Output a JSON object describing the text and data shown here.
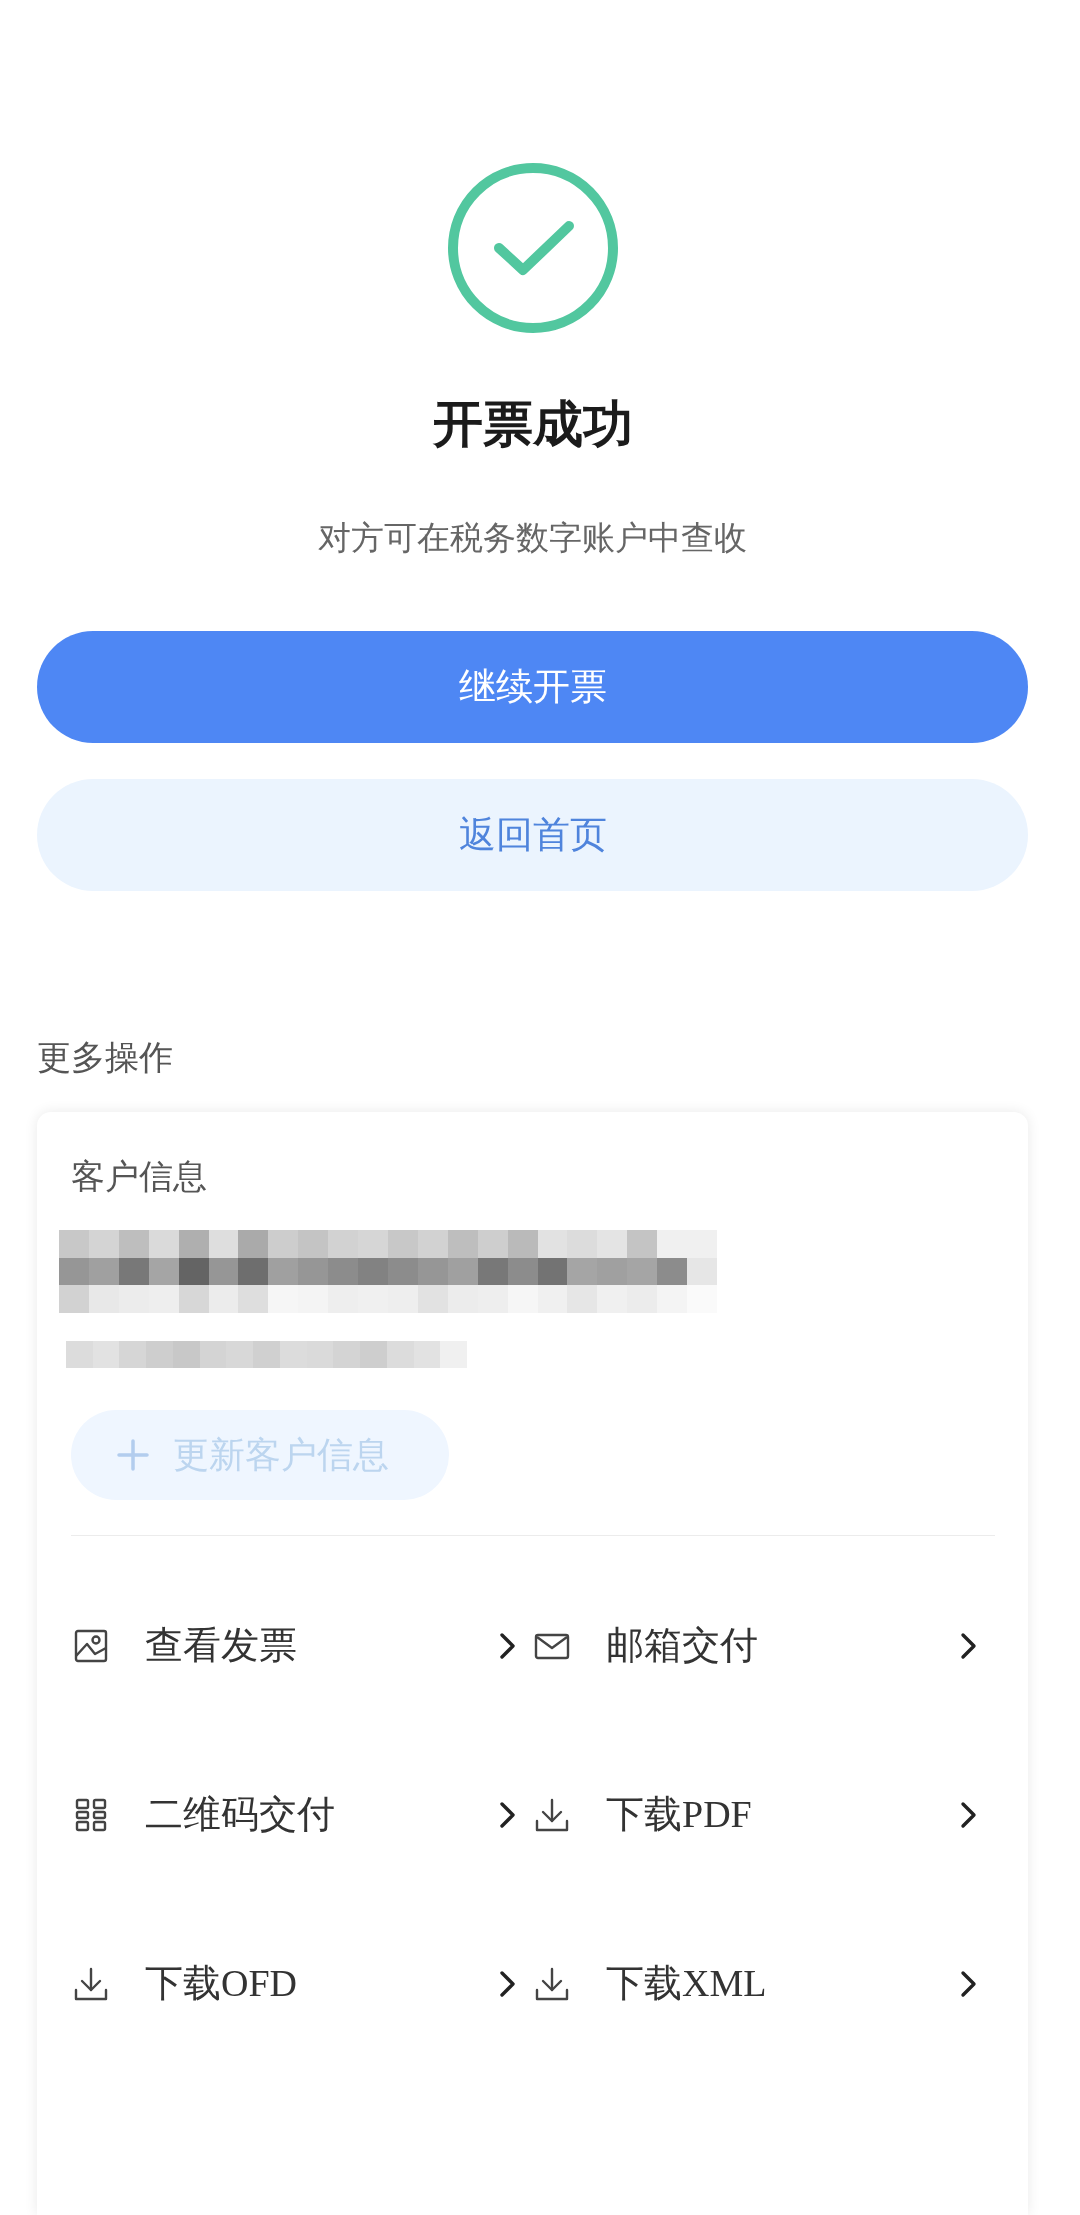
{
  "result": {
    "title": "开票成功",
    "message": "对方可在税务数字账户中查收"
  },
  "buttons": [
    {
      "label": "继续开票",
      "kind": "primary"
    },
    {
      "label": "返回首页",
      "kind": "secondary"
    }
  ],
  "more_actions": {
    "heading": "更多操作",
    "customer": {
      "label": "客户信息",
      "update_button": {
        "label": "更新客户信息",
        "disabled": true
      }
    },
    "actions": [
      {
        "label": "查看发票",
        "kind": "image"
      },
      {
        "label": "邮箱交付",
        "kind": "mail"
      },
      {
        "label": "二维码交付",
        "kind": "qrcode"
      },
      {
        "label": "下载PDF",
        "kind": "download"
      },
      {
        "label": "下载OFD",
        "kind": "download"
      },
      {
        "label": "下载XML",
        "kind": "download"
      }
    ]
  }
}
